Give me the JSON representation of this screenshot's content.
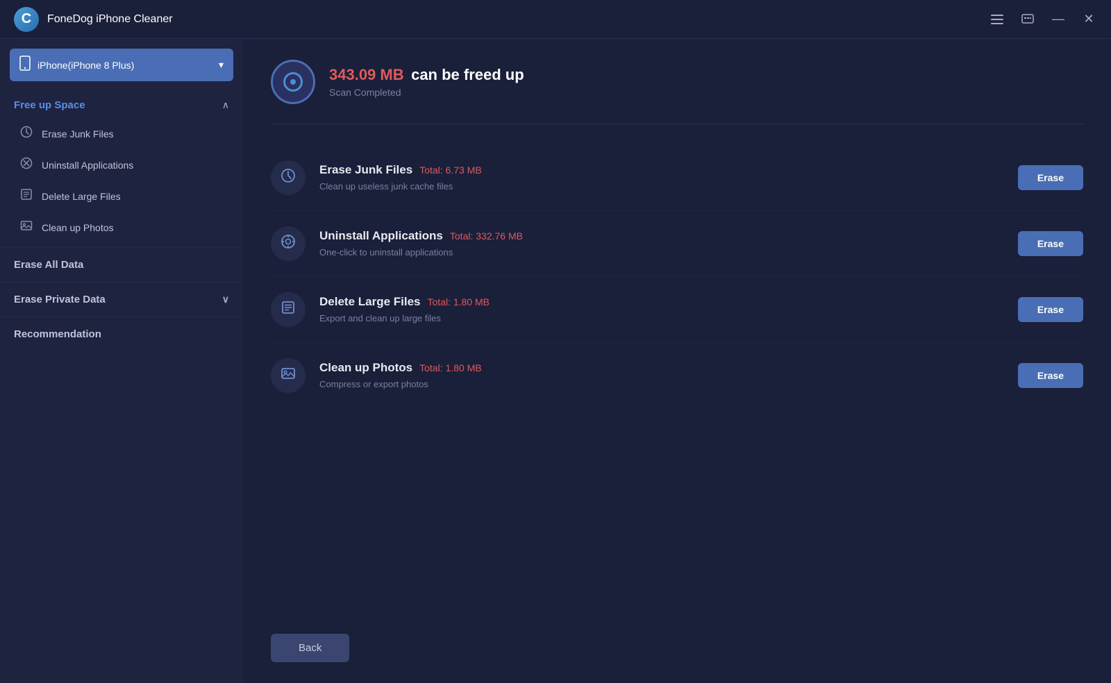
{
  "app": {
    "title": "FoneDog iPhone Cleaner",
    "logo": "C"
  },
  "titlebar": {
    "controls": {
      "menu_icon": "☰",
      "chat_icon": "⬜",
      "minimize_icon": "—",
      "close_icon": "✕"
    }
  },
  "device": {
    "name": "iPhone(iPhone 8 Plus)",
    "chevron": "▾"
  },
  "sidebar": {
    "sections": [
      {
        "id": "free-up-space",
        "title": "Free up Space",
        "expanded": true,
        "chevron": "∧",
        "items": [
          {
            "id": "erase-junk",
            "label": "Erase Junk Files",
            "icon": "⏱"
          },
          {
            "id": "uninstall-apps",
            "label": "Uninstall Applications",
            "icon": "⊗"
          },
          {
            "id": "delete-large",
            "label": "Delete Large Files",
            "icon": "▤"
          },
          {
            "id": "cleanup-photos",
            "label": "Clean up Photos",
            "icon": "🖼"
          }
        ]
      }
    ],
    "nav_items": [
      {
        "id": "erase-all-data",
        "label": "Erase All Data",
        "has_arrow": false
      },
      {
        "id": "erase-private-data",
        "label": "Erase Private Data",
        "has_arrow": true,
        "arrow": "∨"
      },
      {
        "id": "recommendation",
        "label": "Recommendation",
        "has_arrow": false
      }
    ]
  },
  "summary": {
    "amount": "343.09 MB",
    "label": "can be freed up",
    "sub": "Scan Completed",
    "icon_label": "scan-complete-icon"
  },
  "features": [
    {
      "id": "erase-junk-files",
      "title": "Erase Junk Files",
      "total_label": "Total: 6.73 MB",
      "desc": "Clean up useless junk cache files",
      "erase_label": "Erase",
      "icon": "⏱"
    },
    {
      "id": "uninstall-applications",
      "title": "Uninstall Applications",
      "total_label": "Total: 332.76 MB",
      "desc": "One-click to uninstall applications",
      "erase_label": "Erase",
      "icon": "⊛"
    },
    {
      "id": "delete-large-files",
      "title": "Delete Large Files",
      "total_label": "Total: 1.80 MB",
      "desc": "Export and clean up large files",
      "erase_label": "Erase",
      "icon": "▤"
    },
    {
      "id": "clean-up-photos",
      "title": "Clean up Photos",
      "total_label": "Total: 1.80 MB",
      "desc": "Compress or export photos",
      "erase_label": "Erase",
      "icon": "🖼"
    }
  ],
  "footer": {
    "back_label": "Back"
  }
}
